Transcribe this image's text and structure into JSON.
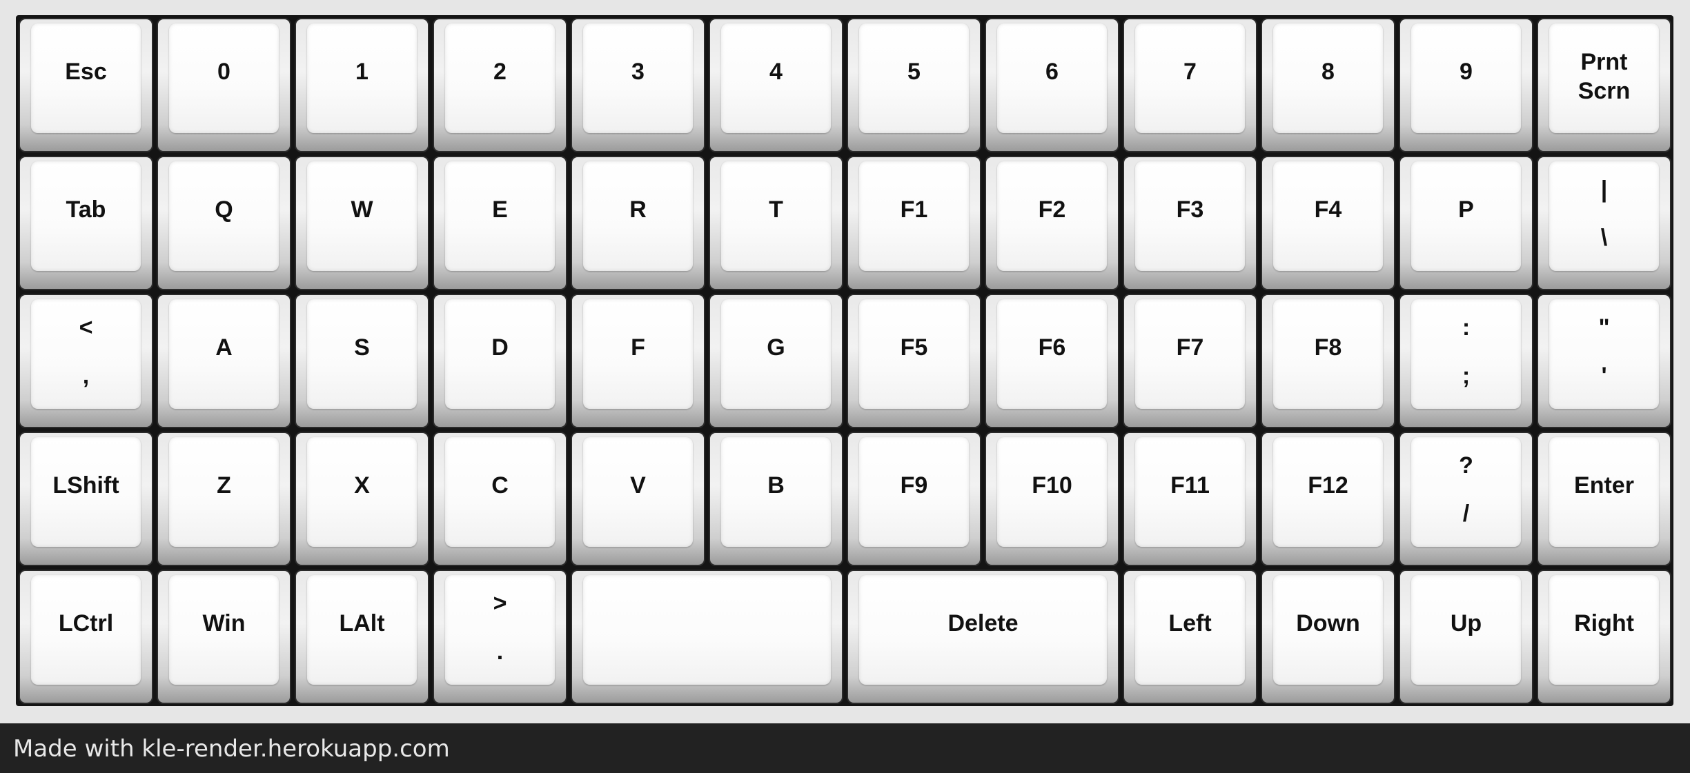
{
  "rows": [
    [
      {
        "id": "esc",
        "label": "Esc"
      },
      {
        "id": "0",
        "label": "0"
      },
      {
        "id": "1",
        "label": "1"
      },
      {
        "id": "2",
        "label": "2"
      },
      {
        "id": "3",
        "label": "3"
      },
      {
        "id": "4",
        "label": "4"
      },
      {
        "id": "5",
        "label": "5"
      },
      {
        "id": "6",
        "label": "6"
      },
      {
        "id": "7",
        "label": "7"
      },
      {
        "id": "8",
        "label": "8"
      },
      {
        "id": "9",
        "label": "9"
      },
      {
        "id": "prntscrn",
        "line1": "Prnt",
        "line2": "Scrn"
      }
    ],
    [
      {
        "id": "tab",
        "label": "Tab"
      },
      {
        "id": "q",
        "label": "Q"
      },
      {
        "id": "w",
        "label": "W"
      },
      {
        "id": "e",
        "label": "E"
      },
      {
        "id": "r",
        "label": "R"
      },
      {
        "id": "t",
        "label": "T"
      },
      {
        "id": "f1",
        "label": "F1"
      },
      {
        "id": "f2",
        "label": "F2"
      },
      {
        "id": "f3",
        "label": "F3"
      },
      {
        "id": "f4",
        "label": "F4"
      },
      {
        "id": "p",
        "label": "P"
      },
      {
        "id": "pipe",
        "top": "|",
        "bottom": "\\"
      }
    ],
    [
      {
        "id": "comma",
        "top": "<",
        "bottom": ","
      },
      {
        "id": "a",
        "label": "A"
      },
      {
        "id": "s",
        "label": "S"
      },
      {
        "id": "d",
        "label": "D"
      },
      {
        "id": "f",
        "label": "F"
      },
      {
        "id": "g",
        "label": "G"
      },
      {
        "id": "f5",
        "label": "F5"
      },
      {
        "id": "f6",
        "label": "F6"
      },
      {
        "id": "f7",
        "label": "F7"
      },
      {
        "id": "f8",
        "label": "F8"
      },
      {
        "id": "semicolon",
        "top": ":",
        "bottom": ";"
      },
      {
        "id": "quote",
        "top": "\"",
        "bottom": "'"
      }
    ],
    [
      {
        "id": "lshift",
        "label": "LShift"
      },
      {
        "id": "z",
        "label": "Z"
      },
      {
        "id": "x",
        "label": "X"
      },
      {
        "id": "c",
        "label": "C"
      },
      {
        "id": "v",
        "label": "V"
      },
      {
        "id": "b",
        "label": "B"
      },
      {
        "id": "f9",
        "label": "F9"
      },
      {
        "id": "f10",
        "label": "F10"
      },
      {
        "id": "f11",
        "label": "F11"
      },
      {
        "id": "f12",
        "label": "F12"
      },
      {
        "id": "slash",
        "top": "?",
        "bottom": "/"
      },
      {
        "id": "enter",
        "label": "Enter"
      }
    ],
    [
      {
        "id": "lctrl",
        "label": "LCtrl"
      },
      {
        "id": "win",
        "label": "Win"
      },
      {
        "id": "lalt",
        "label": "LAlt"
      },
      {
        "id": "period",
        "top": ">",
        "bottom": "."
      },
      {
        "id": "space",
        "label": "",
        "width": 2
      },
      {
        "id": "delete",
        "label": "Delete",
        "width": 2
      },
      {
        "id": "left",
        "label": "Left"
      },
      {
        "id": "down",
        "label": "Down"
      },
      {
        "id": "up",
        "label": "Up"
      },
      {
        "id": "right",
        "label": "Right"
      }
    ]
  ],
  "footer": {
    "text": "Made with kle-render.herokuapp.com"
  }
}
